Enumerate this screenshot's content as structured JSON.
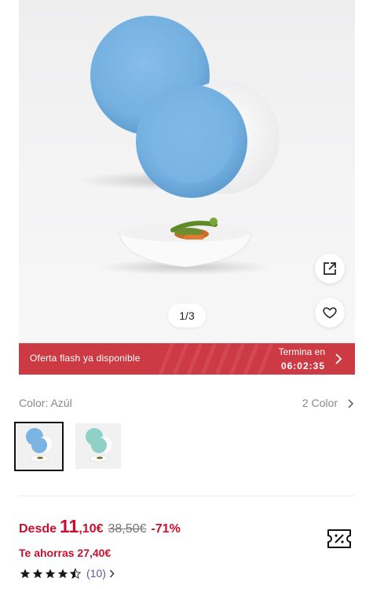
{
  "product": {
    "image_counter": "1/3",
    "icons": {
      "share": "external-link-icon",
      "favorite": "heart-icon",
      "coupon": "coupon-icon",
      "chevron": "chevron-right-icon"
    }
  },
  "flash_sale": {
    "label": "Oferta flash ya disponible",
    "ends_label": "Termina en",
    "timer": "06:02:35",
    "color": "#cc3a44"
  },
  "color_selector": {
    "label": "Color: Azúl",
    "count": "2 Color",
    "options": [
      "Azúl",
      "Verde"
    ]
  },
  "pricing": {
    "prefix": "Desde",
    "price_int": "11",
    "price_dec": ",10€",
    "old_price": "38,50€",
    "discount": "-71%",
    "savings": "Te ahorras 27,40€",
    "accent": "#c8102e"
  },
  "rating": {
    "stars": 4.5,
    "count": "(10)"
  }
}
